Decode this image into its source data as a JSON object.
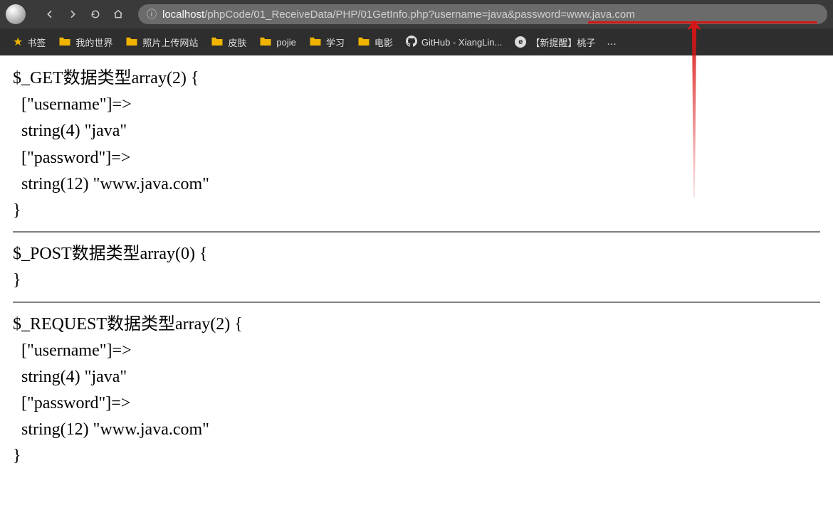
{
  "address_bar": {
    "host": "localhost",
    "path": "/phpCode/01_ReceiveData/PHP/01GetInfo.php",
    "query": "?username=java&password=www.java.com",
    "full": "localhost/phpCode/01_ReceiveData/PHP/01GetInfo.php?username=java&password=www.java.com"
  },
  "bookmarks": {
    "items": [
      {
        "icon": "star",
        "label": "书签"
      },
      {
        "icon": "folder",
        "label": "我的世界"
      },
      {
        "icon": "folder",
        "label": "照片上传网站"
      },
      {
        "icon": "folder",
        "label": "皮肤"
      },
      {
        "icon": "folder",
        "label": "pojie"
      },
      {
        "icon": "folder",
        "label": "学习"
      },
      {
        "icon": "folder",
        "label": "电影"
      },
      {
        "icon": "github",
        "label": "GitHub - XiangLin..."
      },
      {
        "icon": "e",
        "label": "【新提醒】桃子"
      }
    ],
    "overflow": "..."
  },
  "page": {
    "get_block": "$_GET数据类型array(2) {\n  [\"username\"]=>\n  string(4) \"java\"\n  [\"password\"]=>\n  string(12) \"www.java.com\"\n}",
    "post_block": "$_POST数据类型array(0) {\n}",
    "request_block": "$_REQUEST数据类型array(2) {\n  [\"username\"]=>\n  string(4) \"java\"\n  [\"password\"]=>\n  string(12) \"www.java.com\"\n}"
  },
  "annotation": {
    "type": "arrow",
    "color": "#d91515"
  }
}
